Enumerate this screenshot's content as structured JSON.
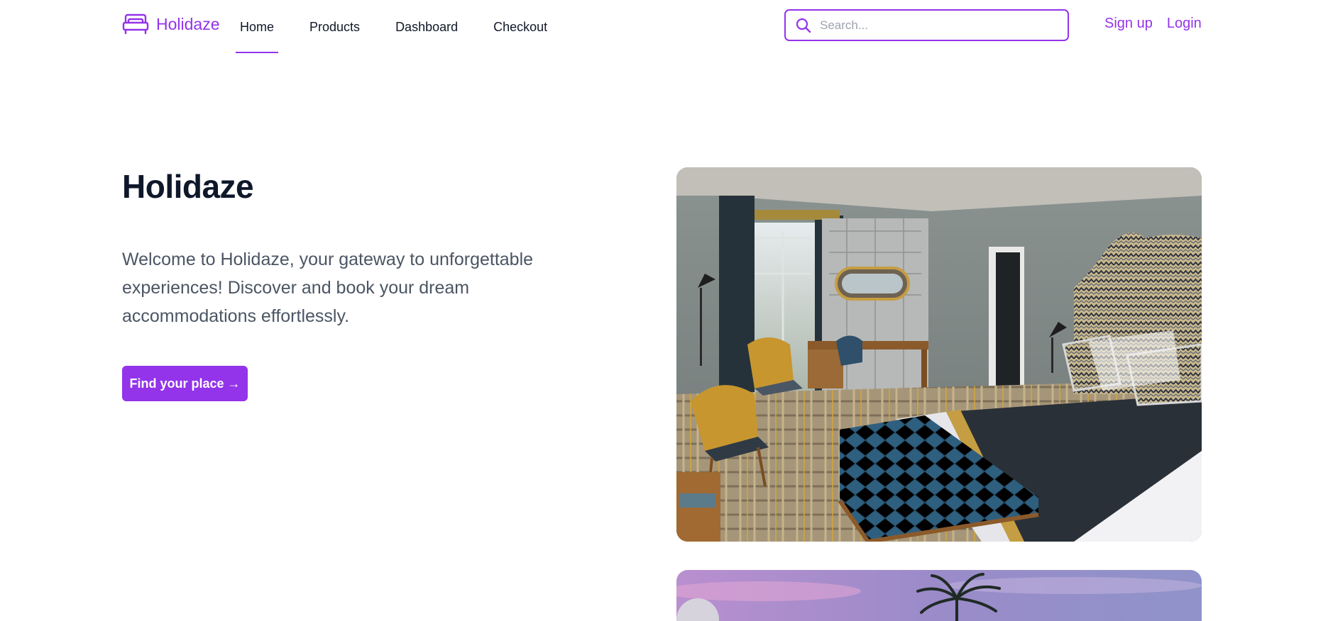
{
  "brand": {
    "name": "Holidaze",
    "icon": "bed-icon"
  },
  "nav": {
    "links": [
      {
        "label": "Home",
        "active": true
      },
      {
        "label": "Products",
        "active": false
      },
      {
        "label": "Dashboard",
        "active": false
      },
      {
        "label": "Checkout",
        "active": false
      }
    ]
  },
  "search": {
    "placeholder": "Search...",
    "value": "",
    "icon": "search-icon"
  },
  "auth": {
    "signup_label": "Sign up",
    "login_label": "Login"
  },
  "hero": {
    "title": "Holidaze",
    "text": "Welcome to Holidaze, your gateway to unforgettable experiences! Discover and book your dream accommodations effortlessly.",
    "cta_label": "Find your place →"
  },
  "colors": {
    "accent": "#9333ea",
    "heading": "#0f172a",
    "body_text": "#4b5563"
  }
}
